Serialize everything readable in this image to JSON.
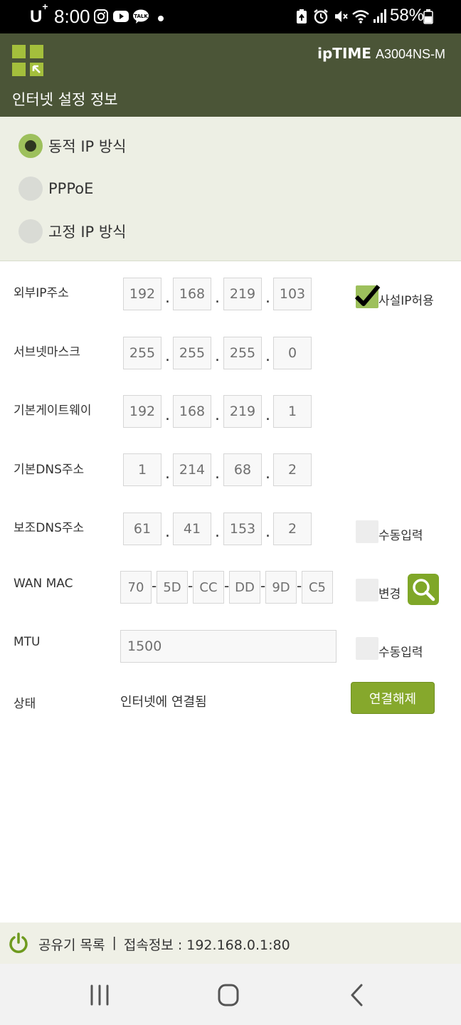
{
  "status_bar": {
    "carrier": "U",
    "carrier_sup": "+",
    "time": "8:00",
    "battery_percent": "58%"
  },
  "header": {
    "brand": "ipTIME",
    "model": "A3004NS-M",
    "title": "인터넷 설정 정보"
  },
  "modes": [
    {
      "label": "동적 IP 방식",
      "checked": true
    },
    {
      "label": "PPPoE",
      "checked": false
    },
    {
      "label": "고정 IP 방식",
      "checked": false
    }
  ],
  "form": {
    "external_ip": {
      "label": "외부IP주소",
      "octets": [
        "192",
        "168",
        "219",
        "103"
      ],
      "option_label": "사설IP허용",
      "option_checked": true
    },
    "subnet_mask": {
      "label": "서브넷마스크",
      "octets": [
        "255",
        "255",
        "255",
        "0"
      ]
    },
    "gateway": {
      "label": "기본게이트웨이",
      "octets": [
        "192",
        "168",
        "219",
        "1"
      ]
    },
    "primary_dns": {
      "label": "기본DNS주소",
      "octets": [
        "1",
        "214",
        "68",
        "2"
      ]
    },
    "secondary_dns": {
      "label": "보조DNS주소",
      "octets": [
        "61",
        "41",
        "153",
        "2"
      ],
      "option_label": "수동입력",
      "option_checked": false
    },
    "wan_mac": {
      "label": "WAN MAC",
      "parts": [
        "70",
        "5D",
        "CC",
        "DD",
        "9D",
        "C5"
      ],
      "option_label": "변경",
      "option_checked": false
    },
    "mtu": {
      "label": "MTU",
      "value": "1500",
      "option_label": "수동입력",
      "option_checked": false
    },
    "status": {
      "label": "상태",
      "value": "인터넷에 연결됨",
      "button_label": "연결해제"
    }
  },
  "footer": {
    "router_list": "공유기 목록",
    "separator": "|",
    "access_info": "접속정보 : 192.168.0.1:80"
  },
  "colors": {
    "header_bg": "#4b5537",
    "accent_green": "#86a82c",
    "logo_green": "#a4bf3c",
    "mode_bg": "#edefe4"
  }
}
